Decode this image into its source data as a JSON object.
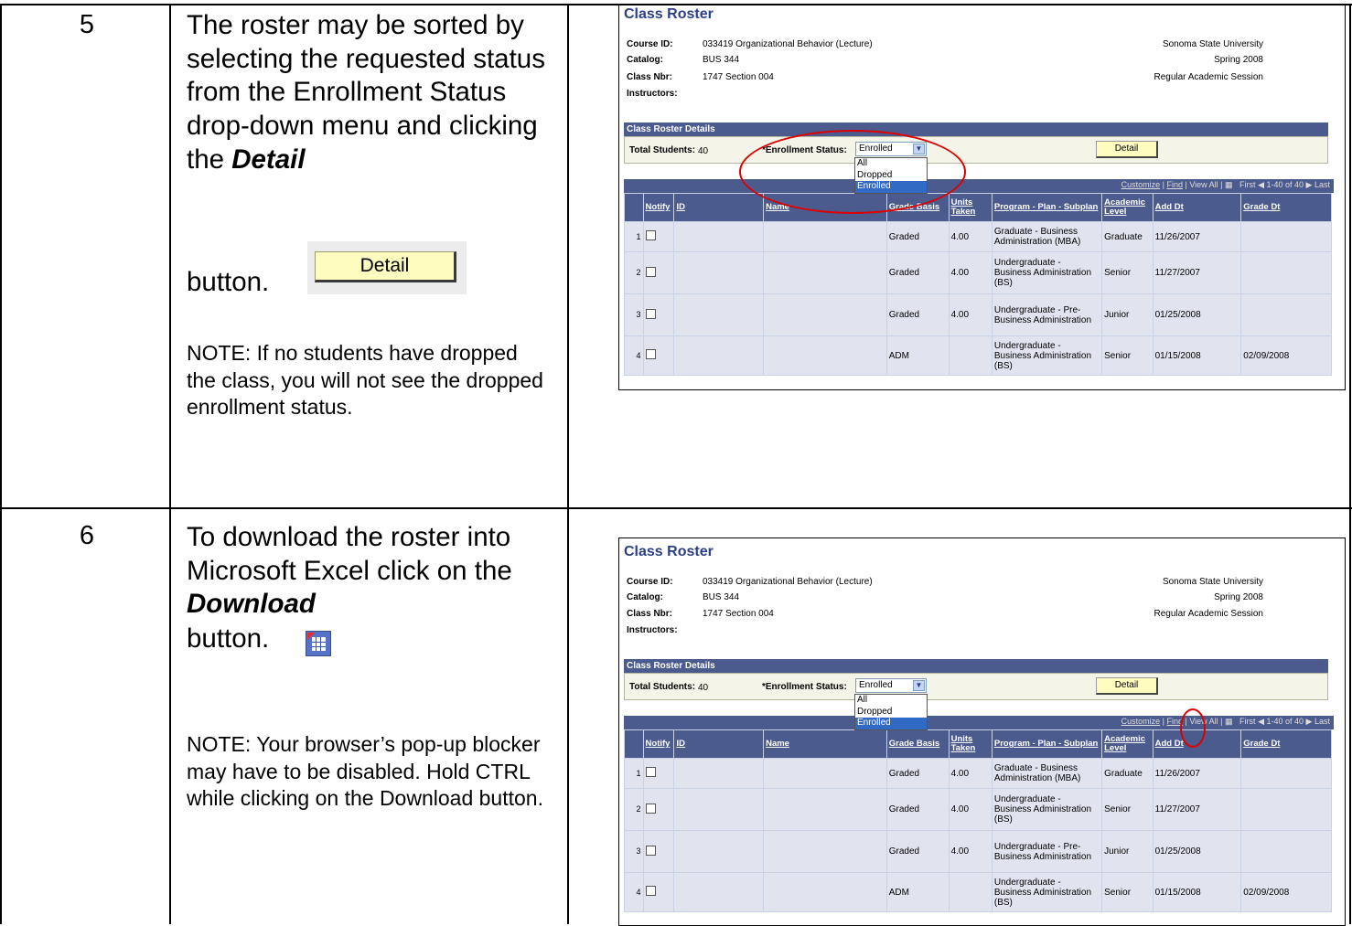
{
  "steps": [
    {
      "number": "5",
      "instruction_pre": "The roster may be sorted by selecting the requested status from the Enrollment Status drop-down menu and clicking the ",
      "instruction_bold": "Detail",
      "instruction_post": "button.",
      "button_image_label": "Detail",
      "note": "NOTE: If no students have dropped the class, you will not see the dropped enrollment status."
    },
    {
      "number": "6",
      "instruction_pre": "To download the roster into Microsoft Excel click on the ",
      "instruction_bold": "Download",
      "instruction_post": "button.",
      "note": "NOTE:  Your browser’s pop-up blocker may have to be disabled.  Hold CTRL while clicking on the Download button."
    }
  ],
  "roster": {
    "title": "Class Roster",
    "course_id_label": "Course ID:",
    "course_id_value": "033419    Organizational Behavior  (Lecture)",
    "catalog_label": "Catalog:",
    "catalog_value": "BUS  344",
    "class_nbr_label": "Class Nbr:",
    "class_nbr_value": "1747   Section 004",
    "instructors_label": "Instructors:",
    "institution": "Sonoma State University",
    "term": "Spring 2008",
    "session": "Regular Academic Session",
    "details_header": "Class Roster Details",
    "total_students_label": "Total Students:",
    "total_students_value": "40",
    "enrollment_status_label": "*Enrollment Status:",
    "enrollment_status_selected": "Enrolled",
    "enrollment_status_options": [
      "All",
      "Dropped",
      "Enrolled"
    ],
    "detail_button": "Detail",
    "grid_nav": {
      "customize": "Customize",
      "find": "Find",
      "view_all": "View All",
      "first": "First",
      "range": "1-40 of 40",
      "last": "Last"
    },
    "columns": [
      "",
      "Notify",
      "ID",
      "Name",
      "Grade Basis",
      "Units Taken",
      "Program - Plan - Subplan",
      "Academic Level",
      "Add Dt",
      "Grade Dt"
    ],
    "rows": [
      {
        "n": "1",
        "grade_basis": "Graded",
        "units": "4.00",
        "program": "Graduate - Business Administration (MBA)",
        "level": "Graduate",
        "add_dt": "11/26/2007",
        "grade_dt": ""
      },
      {
        "n": "2",
        "grade_basis": "Graded",
        "units": "4.00",
        "program": "Undergraduate - Business Administration (BS)",
        "level": "Senior",
        "add_dt": "11/27/2007",
        "grade_dt": ""
      },
      {
        "n": "3",
        "grade_basis": "Graded",
        "units": "4.00",
        "program": "Undergraduate - Pre-Business Administration",
        "level": "Junior",
        "add_dt": "01/25/2008",
        "grade_dt": ""
      },
      {
        "n": "4",
        "grade_basis": "ADM",
        "units": "",
        "program": "Undergraduate - Business Administration (BS)",
        "level": "Senior",
        "add_dt": "01/15/2008",
        "grade_dt": "02/09/2008"
      }
    ]
  },
  "colors": {
    "title_blue": "#2b3f86",
    "header_bar": "#4b5b8e",
    "row_bg": "#e1e4ee",
    "button_yellow": "#fefdbf",
    "highlight_ellipse": "#dd0000"
  }
}
